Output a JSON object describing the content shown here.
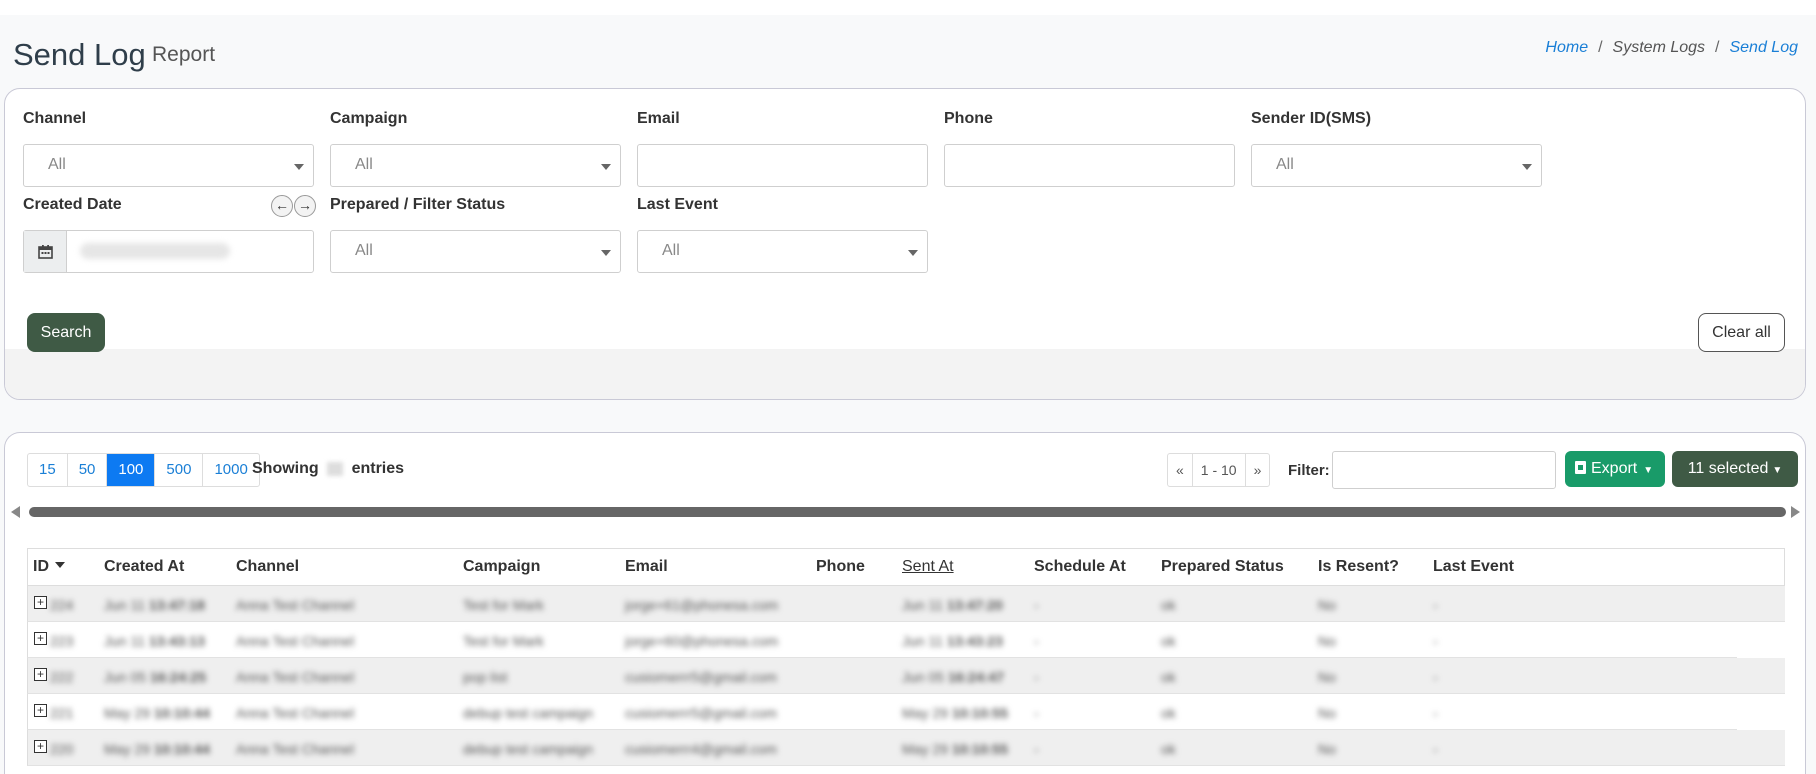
{
  "header": {
    "title": "Send Log",
    "subtitle": "Report",
    "breadcrumb": [
      "Home",
      "System Logs",
      "Send Log"
    ]
  },
  "filters": {
    "channel": {
      "label": "Channel",
      "value": "All"
    },
    "campaign": {
      "label": "Campaign",
      "value": "All"
    },
    "email": {
      "label": "Email",
      "value": ""
    },
    "phone": {
      "label": "Phone",
      "value": ""
    },
    "sender_id": {
      "label": "Sender ID(SMS)",
      "value": "All"
    },
    "created_date": {
      "label": "Created Date",
      "prev_icon": "arrow-left-icon",
      "next_icon": "arrow-right-icon"
    },
    "prepared_status": {
      "label": "Prepared / Filter Status",
      "value": "All"
    },
    "last_event": {
      "label": "Last Event",
      "value": "All"
    },
    "search_label": "Search",
    "clear_label": "Clear all"
  },
  "toolbar": {
    "page_sizes": [
      "15",
      "50",
      "100",
      "500",
      "1000"
    ],
    "active_page_size": "100",
    "showing_prefix": "Showing",
    "showing_suffix": "entries",
    "pager": [
      "«",
      "1 - 10",
      "»"
    ],
    "filter_label": "Filter:",
    "export_label": "Export",
    "selected_label": "11 selected"
  },
  "table": {
    "columns": [
      "ID",
      "Created At",
      "Channel",
      "Campaign",
      "Email",
      "Phone",
      "Sent At",
      "Schedule At",
      "Prepared Status",
      "Is Resent?",
      "Last Event"
    ],
    "rows": [
      {
        "id": "224",
        "created_date": "Jun 11",
        "created_time": "13:47:18",
        "channel": "Anna Test Channel",
        "campaign": "Test for Mark",
        "email": "jorge+61@phonesa.com",
        "sent_date": "Jun 11",
        "sent_time": "13:47:20",
        "schedule": "-",
        "prepared": "ok",
        "resent": "No",
        "last_event": "-"
      },
      {
        "id": "223",
        "created_date": "Jun 11",
        "created_time": "13:43:13",
        "channel": "Anna Test Channel",
        "campaign": "Test for Mark",
        "email": "jorge+60@phonesa.com",
        "sent_date": "Jun 11",
        "sent_time": "13:43:23",
        "schedule": "-",
        "prepared": "ok",
        "resent": "No",
        "last_event": "-"
      },
      {
        "id": "222",
        "created_date": "Jun 05",
        "created_time": "16:24:25",
        "channel": "Anna Test Channel",
        "campaign": "pop list",
        "email": "cusiomerrr5@gmail.com",
        "sent_date": "Jun 05",
        "sent_time": "16:24:47",
        "schedule": "-",
        "prepared": "ok",
        "resent": "No",
        "last_event": "-"
      },
      {
        "id": "221",
        "created_date": "May 29",
        "created_time": "10:10:44",
        "channel": "Anna Test Channel",
        "campaign": "debup test campaign",
        "email": "cusiomerrr5@gmail.com",
        "sent_date": "May 29",
        "sent_time": "10:10:55",
        "schedule": "-",
        "prepared": "ok",
        "resent": "No",
        "last_event": "-"
      },
      {
        "id": "220",
        "created_date": "May 29",
        "created_time": "10:10:44",
        "channel": "Anna Test Channel",
        "campaign": "debup test campaign",
        "email": "cusiomerrr4@gmail.com",
        "sent_date": "May 29",
        "sent_time": "10:10:55",
        "schedule": "-",
        "prepared": "ok",
        "resent": "No",
        "last_event": "-"
      }
    ]
  }
}
